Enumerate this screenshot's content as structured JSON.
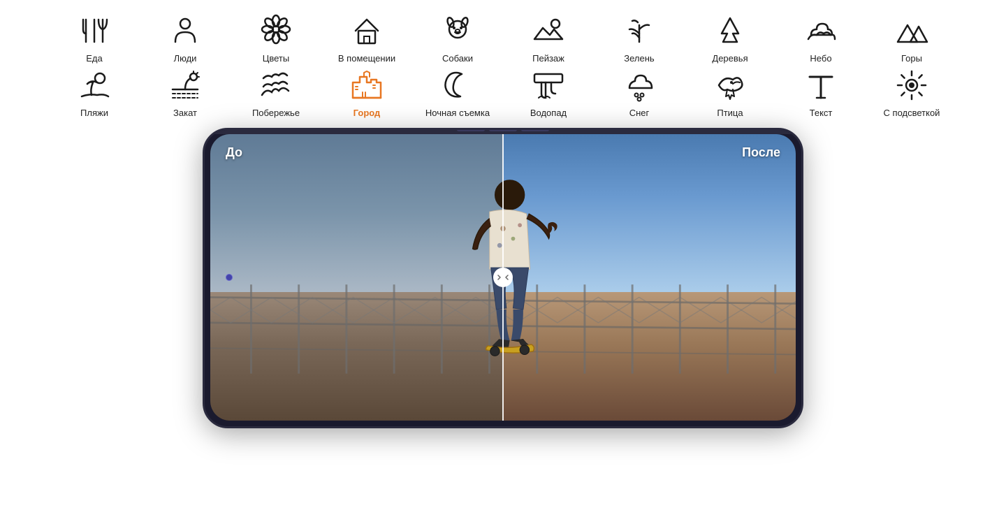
{
  "icons_row1": [
    {
      "id": "food",
      "label": "Еда",
      "symbol": "🍴",
      "active": false
    },
    {
      "id": "people",
      "label": "Люди",
      "symbol": "👤",
      "active": false
    },
    {
      "id": "flowers",
      "label": "Цветы",
      "symbol": "🌸",
      "active": false
    },
    {
      "id": "indoor",
      "label": "В помещении",
      "symbol": "🏠",
      "active": false
    },
    {
      "id": "dogs",
      "label": "Собаки",
      "symbol": "🐶",
      "active": false
    },
    {
      "id": "landscape",
      "label": "Пейзаж",
      "symbol": "🌅",
      "active": false
    },
    {
      "id": "greens",
      "label": "Зелень",
      "symbol": "🌿",
      "active": false
    },
    {
      "id": "trees",
      "label": "Деревья",
      "symbol": "🌲",
      "active": false
    },
    {
      "id": "sky",
      "label": "Небо",
      "symbol": "☁",
      "active": false
    },
    {
      "id": "mountains",
      "label": "Горы",
      "symbol": "⛰",
      "active": false
    }
  ],
  "icons_row2": [
    {
      "id": "beach",
      "label": "Пляжи",
      "symbol": "🏖",
      "active": false
    },
    {
      "id": "sunset",
      "label": "Закат",
      "symbol": "🌅",
      "active": false
    },
    {
      "id": "coast",
      "label": "Побережье",
      "symbol": "🌊",
      "active": false
    },
    {
      "id": "city",
      "label": "Город",
      "symbol": "🏙",
      "active": true
    },
    {
      "id": "night",
      "label": "Ночная съемка",
      "symbol": "🌙",
      "active": false
    },
    {
      "id": "waterfall",
      "label": "Водопад",
      "symbol": "💧",
      "active": false
    },
    {
      "id": "snow",
      "label": "Снег",
      "symbol": "❄",
      "active": false
    },
    {
      "id": "bird",
      "label": "Птица",
      "symbol": "🐦",
      "active": false
    },
    {
      "id": "text",
      "label": "Текст",
      "symbol": "T",
      "active": false
    },
    {
      "id": "backlight",
      "label": "С подсветкой",
      "symbol": "💡",
      "active": false
    }
  ],
  "phone": {
    "label_before": "До",
    "label_after": "После"
  },
  "colors": {
    "active_label": "#e87722",
    "inactive_icon": "#1a1a1a",
    "phone_body": "#1c1c2e",
    "split_line": "rgba(255,255,255,0.9)"
  }
}
